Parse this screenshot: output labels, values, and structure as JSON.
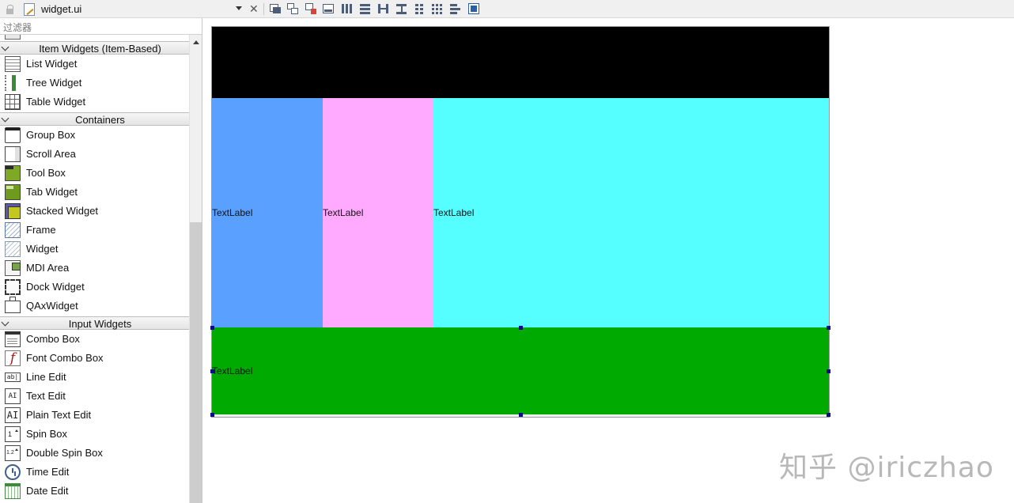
{
  "file": {
    "name": "widget.ui"
  },
  "widgetbox": {
    "filter_placeholder": "过滤器",
    "categories": [
      {
        "title": "Item Widgets (Item-Based)",
        "items": [
          {
            "label": "List Widget",
            "icon": "list-widget-icon"
          },
          {
            "label": "Tree Widget",
            "icon": "tree-widget-icon"
          },
          {
            "label": "Table Widget",
            "icon": "table-widget-icon"
          }
        ]
      },
      {
        "title": "Containers",
        "items": [
          {
            "label": "Group Box",
            "icon": "group-box-icon"
          },
          {
            "label": "Scroll Area",
            "icon": "scroll-area-icon"
          },
          {
            "label": "Tool Box",
            "icon": "tool-box-icon"
          },
          {
            "label": "Tab Widget",
            "icon": "tab-widget-icon"
          },
          {
            "label": "Stacked Widget",
            "icon": "stacked-widget-icon"
          },
          {
            "label": "Frame",
            "icon": "frame-icon"
          },
          {
            "label": "Widget",
            "icon": "widget-icon"
          },
          {
            "label": "MDI Area",
            "icon": "mdi-area-icon"
          },
          {
            "label": "Dock Widget",
            "icon": "dock-widget-icon"
          },
          {
            "label": "QAxWidget",
            "icon": "qaxwidget-icon"
          }
        ]
      },
      {
        "title": "Input Widgets",
        "items": [
          {
            "label": "Combo Box",
            "icon": "combo-box-icon"
          },
          {
            "label": "Font Combo Box",
            "icon": "font-combo-box-icon"
          },
          {
            "label": "Line Edit",
            "icon": "line-edit-icon"
          },
          {
            "label": "Text Edit",
            "icon": "text-edit-icon"
          },
          {
            "label": "Plain Text Edit",
            "icon": "plain-text-edit-icon"
          },
          {
            "label": "Spin Box",
            "icon": "spin-box-icon"
          },
          {
            "label": "Double Spin Box",
            "icon": "double-spin-box-icon"
          },
          {
            "label": "Time Edit",
            "icon": "time-edit-icon"
          },
          {
            "label": "Date Edit",
            "icon": "date-edit-icon"
          }
        ]
      }
    ],
    "icon_glyphs": {
      "font": "f",
      "line_edit": "ab|",
      "text_edit": "AI",
      "plain_text_edit": "AI",
      "spin": "1",
      "double_spin": "1.2"
    }
  },
  "form": {
    "labels": {
      "blue": "TextLabel",
      "pink": "TextLabel",
      "cyan": "TextLabel",
      "green": "TextLabel"
    },
    "colors": {
      "black": "#000000",
      "blue": "#5aa1ff",
      "pink": "#ffaaff",
      "cyan": "#55ffff",
      "green": "#00aa00",
      "selection_handle": "#0a0a8a"
    }
  },
  "watermark": "知乎 @iriczhao"
}
